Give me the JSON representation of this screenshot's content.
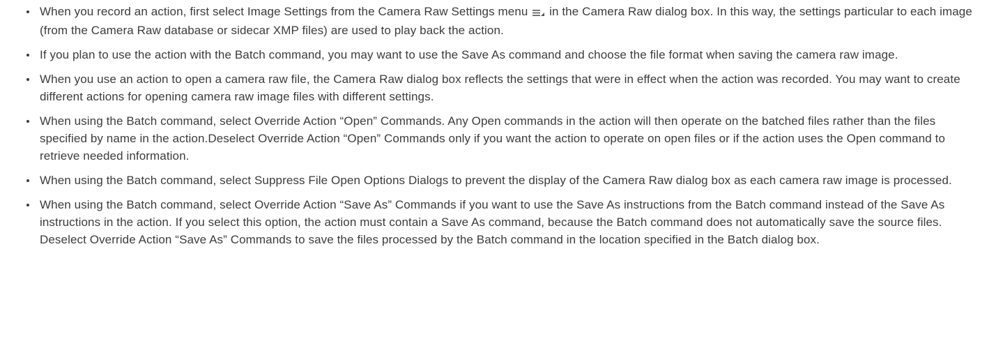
{
  "bullets": [
    {
      "before_icon": "When you record an action, first select Image Settings from the Camera Raw Settings menu ",
      "icon": "camera-raw-settings-menu-icon",
      "after_icon": " in the Camera Raw dialog box. In this way, the settings particular to each image (from the Camera Raw database or sidecar XMP files) are used to play back the action."
    },
    {
      "text": "If you plan to use the action with the Batch command, you may want to use the Save As command and choose the file format when saving the camera raw image."
    },
    {
      "text": "When you use an action to open a camera raw file, the Camera Raw dialog box reflects the settings that were in effect when the action was recorded. You may want to create different actions for opening camera raw image files with different settings."
    },
    {
      "text": "When using the Batch command, select Override Action “Open” Commands. Any Open commands in the action will then operate on the batched files rather than the files specified by name in the action.Deselect Override Action “Open” Commands only if you want the action to operate on open files or if the action uses the Open command to retrieve needed information."
    },
    {
      "text": "When using the Batch command, select Suppress File Open Options Dialogs to prevent the display of the Camera Raw dialog box as each camera raw image is processed."
    },
    {
      "text": "When using the Batch command, select Override Action “Save As” Commands if you want to use the Save As instructions from the Batch command instead of the Save As instructions in the action. If you select this option, the action must contain a Save As command, because the Batch command does not automatically save the source files. Deselect Override Action “Save As” Commands to save the files processed by the Batch command in the location specified in the Batch dialog box."
    }
  ]
}
